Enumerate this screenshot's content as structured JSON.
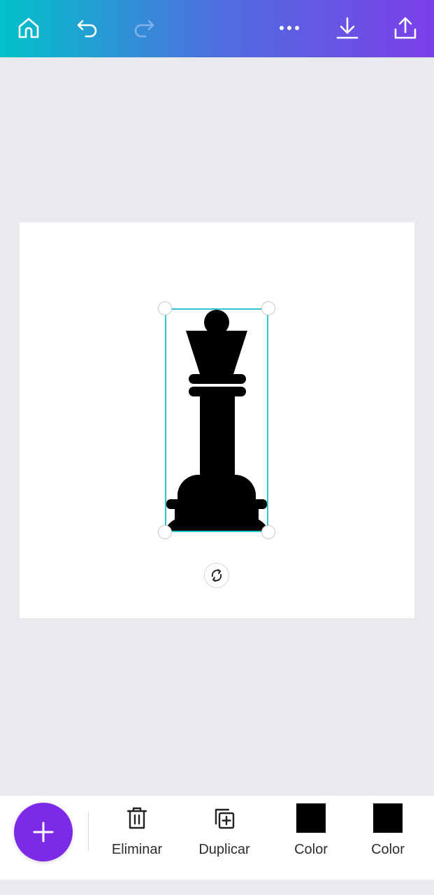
{
  "topbar": {
    "icons": [
      "home-icon",
      "undo-icon",
      "redo-icon",
      "more-icon",
      "download-icon",
      "share-icon"
    ],
    "gradient": [
      "#01c2c9",
      "#4f6fe0",
      "#7b3fe8"
    ]
  },
  "canvas": {
    "element": "chess-king-silhouette",
    "rotate_icon": "rotate-icon",
    "selection_color": "#2ec5cf"
  },
  "toolbar": {
    "add_icon": "plus-icon",
    "add_color": "#7d2ae8",
    "tools": [
      {
        "label": "Eliminar",
        "icon": "trash-icon"
      },
      {
        "label": "Duplicar",
        "icon": "duplicate-icon"
      },
      {
        "label": "Color",
        "icon": "color-swatch",
        "color": "#000000"
      },
      {
        "label": "Color",
        "icon": "color-swatch",
        "color": "#000000"
      }
    ]
  }
}
